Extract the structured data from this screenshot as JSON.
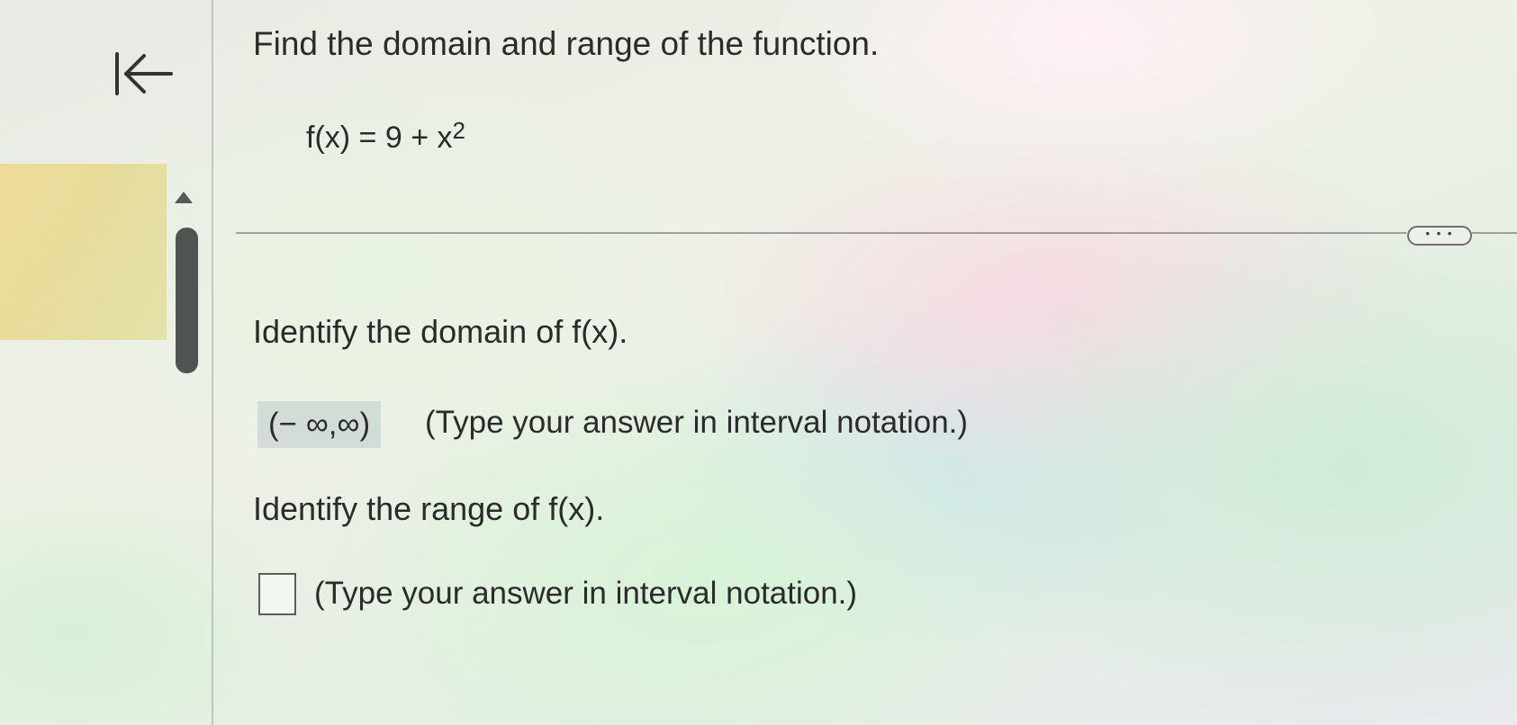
{
  "question": {
    "title": "Find the domain and range of the function.",
    "equation_base": "f(x) = 9 + x",
    "equation_exponent": "2"
  },
  "toolbar": {
    "more_label": "• • •"
  },
  "domain": {
    "prompt": "Identify the domain of f(x).",
    "answer": "(− ∞,∞)",
    "hint": "(Type your answer in interval notation.)"
  },
  "range": {
    "prompt": "Identify the range of f(x).",
    "answer_value": "",
    "hint": "(Type your answer in interval notation.)"
  },
  "icons": {
    "back": "back-to-start-icon",
    "scroll_up": "triangle-up-icon"
  }
}
